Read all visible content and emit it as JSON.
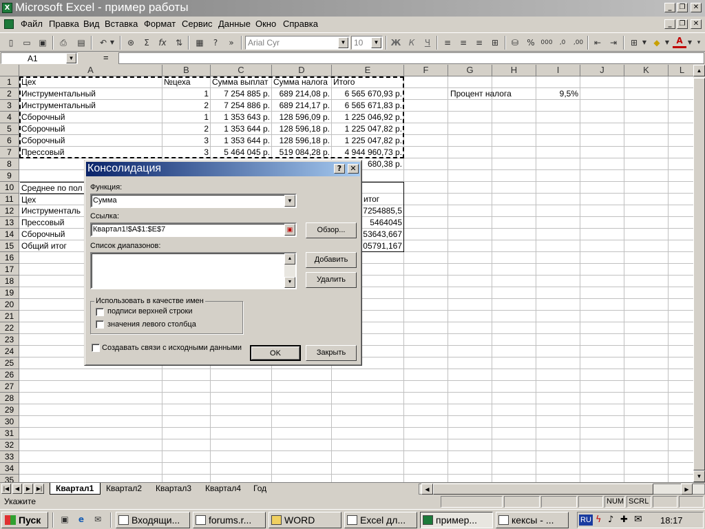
{
  "window": {
    "title": "Microsoft Excel - пример работы",
    "app_icon": "excel-icon",
    "controls": [
      "_",
      "❐",
      "✕"
    ],
    "doc_controls": [
      "_",
      "❐",
      "✕"
    ]
  },
  "menu": [
    "Файл",
    "Правка",
    "Вид",
    "Вставка",
    "Формат",
    "Сервис",
    "Данные",
    "Окно",
    "Справка"
  ],
  "toolbar": {
    "font": "Arial Cyr",
    "size": "10",
    "bold": "Ж",
    "italic": "К",
    "underline": "Ч",
    "percent": "%",
    "thousands": "000",
    "decimals_inc": "‚0",
    "decimals_dec": ",00"
  },
  "formula_bar": {
    "name_box": "A1",
    "equals": "=",
    "value": ""
  },
  "columns": [
    "A",
    "B",
    "C",
    "D",
    "E",
    "F",
    "G",
    "H",
    "I",
    "J",
    "K",
    "L"
  ],
  "rows": [
    "1",
    "2",
    "3",
    "4",
    "5",
    "6",
    "7",
    "8",
    "9",
    "10",
    "11",
    "12",
    "13",
    "14",
    "15",
    "16",
    "17",
    "18",
    "19",
    "20",
    "21",
    "22",
    "23",
    "24",
    "25",
    "26",
    "27",
    "28",
    "29",
    "30",
    "31",
    "32",
    "33",
    "34",
    "35"
  ],
  "cells": {
    "r1": [
      "Цех",
      "№цеха",
      "Сумма выплат",
      "Сумма налога",
      "Итого"
    ],
    "r2": [
      "Инструментальный",
      "1",
      "7 254 885 р.",
      "689 214,08 р.",
      "6 565 670,93 р."
    ],
    "r3": [
      "Инструментальный",
      "2",
      "7 254 886 р.",
      "689 214,17 р.",
      "6 565 671,83 р."
    ],
    "r4": [
      "Сборочный",
      "1",
      "1 353 643 р.",
      "128 596,09 р.",
      "1 225 046,92 р."
    ],
    "r5": [
      "Сборочный",
      "2",
      "1 353 644 р.",
      "128 596,18 р.",
      "1 225 047,82 р."
    ],
    "r6": [
      "Сборочный",
      "3",
      "1 353 644 р.",
      "128 596,18 р.",
      "1 225 047,82 р."
    ],
    "r7": [
      "Прессовый",
      "3",
      "5 464 045 р.",
      "519 084,28 р.",
      "4 944 960,73 р."
    ],
    "r8_e": "680,38 р.",
    "r10_a": "Среднее по пол",
    "r11_a": "Цех",
    "r11_e": "итог",
    "r12": [
      "Инструменталь",
      "7254885,5"
    ],
    "r13": [
      "Прессовый",
      "5464045"
    ],
    "r14": [
      "Сборочный",
      "53643,667"
    ],
    "r15": [
      "Общий итог",
      "05791,167"
    ],
    "tax_label": "Процент налога",
    "tax_value": "9,5%"
  },
  "dialog": {
    "title": "Консолидация",
    "help": "?",
    "close": "✕",
    "function_label": "Функция:",
    "function_value": "Сумма",
    "reference_label": "Ссылка:",
    "reference_value": "Квартал1!$A$1:$E$7",
    "browse_button": "Обзор...",
    "ranges_label": "Список диапазонов:",
    "add_button": "Добавить",
    "delete_button": "Удалить",
    "use_labels_group": "Использовать в качестве имен",
    "top_row": "подписи верхней строки",
    "left_column": "значения левого столбца",
    "links": "Создавать связи с исходными данными",
    "ok_button": "OK",
    "close_button": "Закрыть"
  },
  "sheets": [
    "Квартал1",
    "Квартал2",
    "Квартал3",
    "Квартал4",
    "Год"
  ],
  "status": {
    "text": "Укажите",
    "num": "NUM",
    "scrl": "SCRL"
  },
  "taskbar": {
    "start": "Пуск",
    "tasks": [
      "Входящи...",
      "forums.r...",
      "WORD",
      "Excel дл...",
      "пример...",
      "кексы - ..."
    ],
    "lang": "RU",
    "clock": "18:17"
  }
}
